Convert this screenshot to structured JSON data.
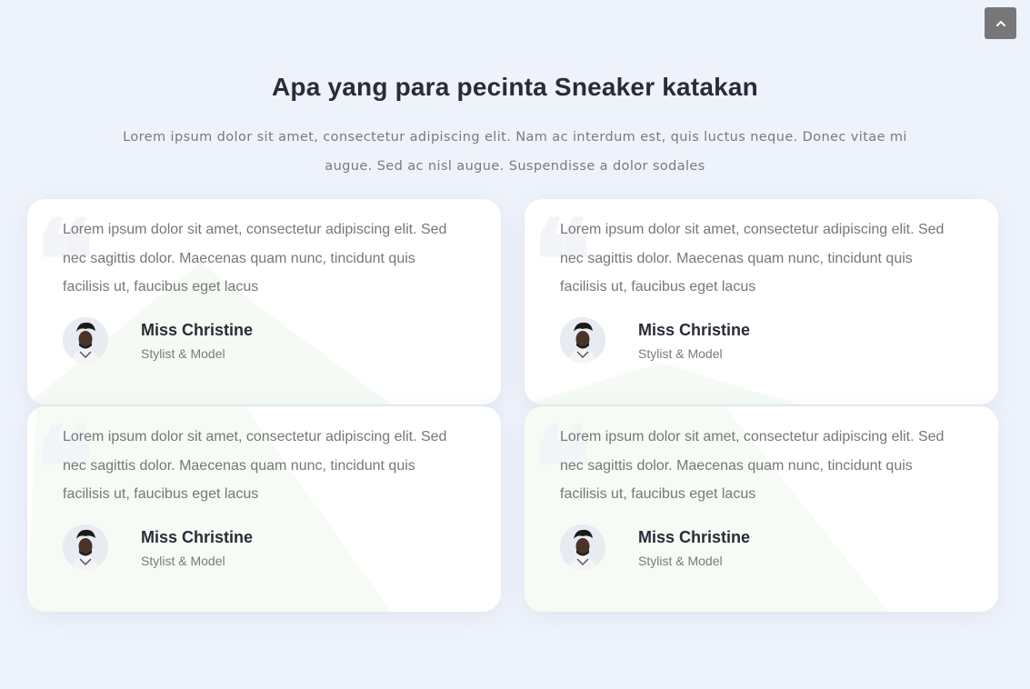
{
  "header": {
    "title": "Apa yang para pecinta Sneaker katakan",
    "subtitle": "Lorem ipsum dolor sit amet, consectetur adipiscing elit. Nam ac interdum est, quis luctus neque. Donec vitae mi augue. Sed ac nisl augue. Suspendisse a dolor sodales"
  },
  "scroll_top": {
    "icon": "chevron-up-icon"
  },
  "testimonials": [
    {
      "text": "Lorem ipsum dolor sit amet, consectetur adipiscing elit. Sed nec sagittis dolor. Maecenas quam nunc, tincidunt quis facilisis ut, faucibus eget lacus",
      "name": "Miss Christine",
      "role": "Stylist & Model"
    },
    {
      "text": "Lorem ipsum dolor sit amet, consectetur adipiscing elit. Sed nec sagittis dolor. Maecenas quam nunc, tincidunt quis facilisis ut, faucibus eget lacus",
      "name": "Miss Christine",
      "role": "Stylist & Model"
    },
    {
      "text": "Lorem ipsum dolor sit amet, consectetur adipiscing elit. Sed nec sagittis dolor. Maecenas quam nunc, tincidunt quis facilisis ut, faucibus eget lacus",
      "name": "Miss Christine",
      "role": "Stylist & Model"
    },
    {
      "text": "Lorem ipsum dolor sit amet, consectetur adipiscing elit. Sed nec sagittis dolor. Maecenas quam nunc, tincidunt quis facilisis ut, faucibus eget lacus",
      "name": "Miss Christine",
      "role": "Stylist & Model"
    }
  ],
  "colors": {
    "background": "#eef3fb",
    "card": "#ffffff",
    "heading": "#2b2b38",
    "body_text": "#777777",
    "scroll_button": "#77777a",
    "decor_green": "#f4fbf3"
  }
}
